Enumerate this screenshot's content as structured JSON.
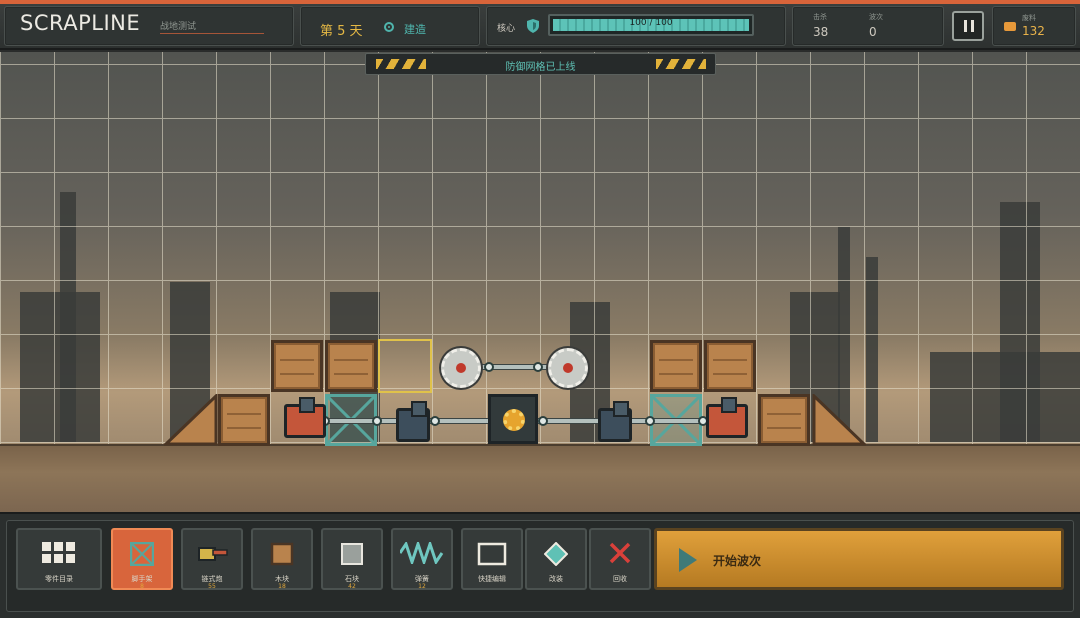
{
  "header": {
    "title": "SCRAPLINE",
    "subtitle": "战地测试",
    "day": "第 5 天",
    "mode": "建造",
    "core_label": "核心",
    "core_hp_text": "100 / 100",
    "core_hp_fraction": 1.0,
    "stats": [
      {
        "label": "击杀",
        "value": "38"
      },
      {
        "label": "波次",
        "value": "0"
      }
    ],
    "scrap_label": "废料",
    "scrap_value": "132"
  },
  "banner": {
    "text": "防御网格已上线"
  },
  "toolbar": {
    "catalog_label": "零件目录",
    "tools": [
      {
        "label": "脚手架",
        "cost": "8",
        "active": true
      },
      {
        "label": "链式炮",
        "cost": "55"
      },
      {
        "label": "木块",
        "cost": "18"
      },
      {
        "label": "石块",
        "cost": "42"
      },
      {
        "label": "弹簧",
        "cost": "12"
      },
      {
        "label": "快捷编辑",
        "cost": ""
      },
      {
        "label": "改装",
        "cost": ""
      },
      {
        "label": "回收",
        "cost": ""
      }
    ],
    "start_label": "开始波次"
  },
  "colors": {
    "accent": "#d8643a",
    "teal": "#4fb5ad",
    "gold": "#e0a03b",
    "danger": "#d9403a"
  },
  "icons": [
    "shield-icon",
    "pause-icon",
    "scrap-icon",
    "grid-icon",
    "play-icon",
    "close-icon"
  ]
}
